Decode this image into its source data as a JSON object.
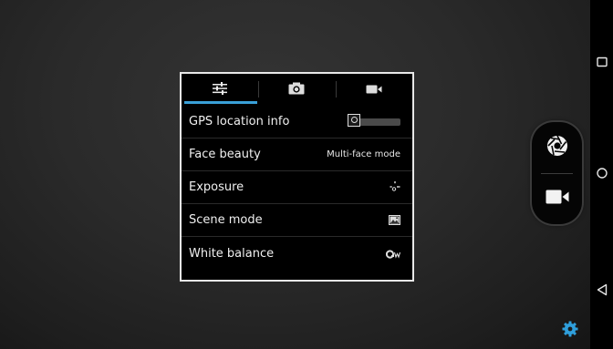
{
  "settings_panel": {
    "tabs": [
      {
        "icon": "sliders-icon",
        "selected": true
      },
      {
        "icon": "camera-icon",
        "selected": false
      },
      {
        "icon": "video-camera-icon",
        "selected": false
      }
    ],
    "accent_color": "#3aa0d8",
    "rows": [
      {
        "label": "GPS location info",
        "control": "toggle",
        "toggle_on": false
      },
      {
        "label": "Face beauty",
        "value": "Multi-face mode"
      },
      {
        "label": "Exposure",
        "icon": "exposure-icon"
      },
      {
        "label": "Scene mode",
        "icon": "scene-landscape-icon"
      },
      {
        "label": "White balance",
        "icon": "white-balance-auto-icon"
      }
    ]
  },
  "capture_controls": {
    "shutter_icon": "shutter-aperture-icon",
    "video_icon": "video-record-icon"
  },
  "settings_icon": "gear-icon",
  "navigation": {
    "buttons": [
      "recent-apps-icon",
      "home-icon",
      "back-icon"
    ]
  }
}
